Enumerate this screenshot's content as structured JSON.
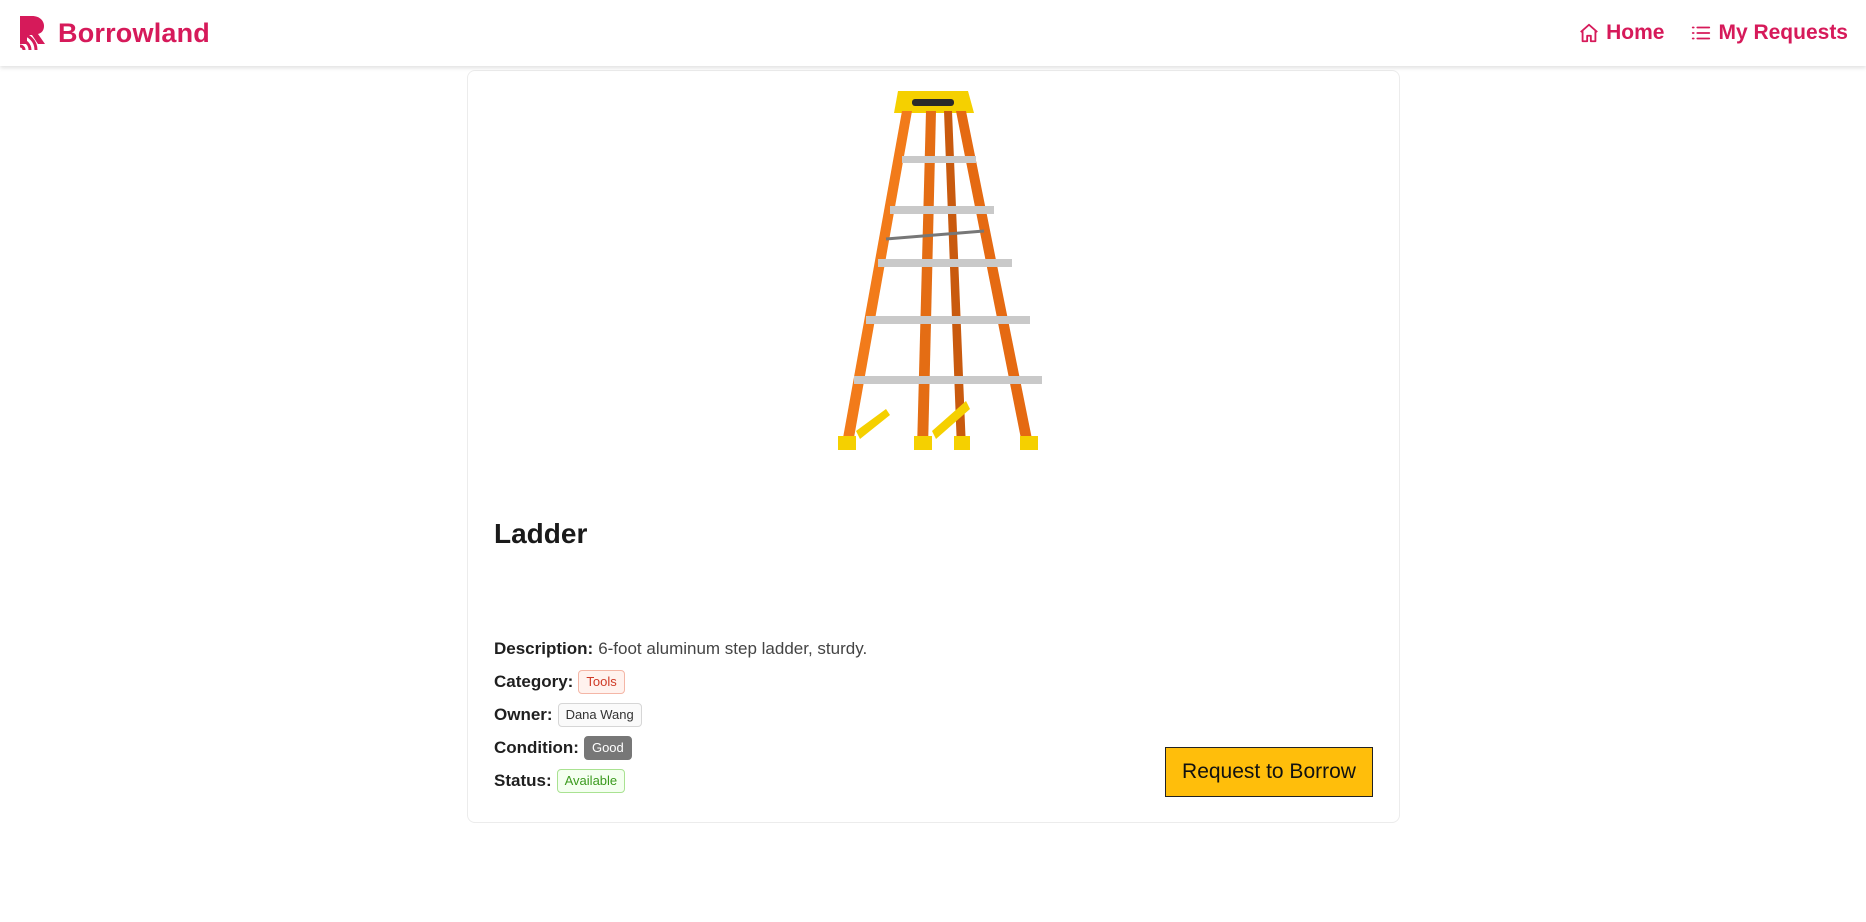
{
  "app": {
    "brand": "Borrowland",
    "brand_color": "#d61a5a"
  },
  "nav": {
    "home": {
      "label": "Home",
      "icon": "home-icon"
    },
    "requests": {
      "label": "My Requests",
      "icon": "list-icon"
    }
  },
  "item": {
    "title": "Ladder",
    "image": "step-ladder-image",
    "description_label": "Description:",
    "description": "6-foot aluminum step ladder, sturdy.",
    "category_label": "Category:",
    "category": "Tools",
    "owner_label": "Owner:",
    "owner": "Dana Wang",
    "condition_label": "Condition:",
    "condition": "Good",
    "status_label": "Status:",
    "status": "Available"
  },
  "actions": {
    "request_label": "Request to Borrow",
    "request_color": "#ffbe0b"
  }
}
